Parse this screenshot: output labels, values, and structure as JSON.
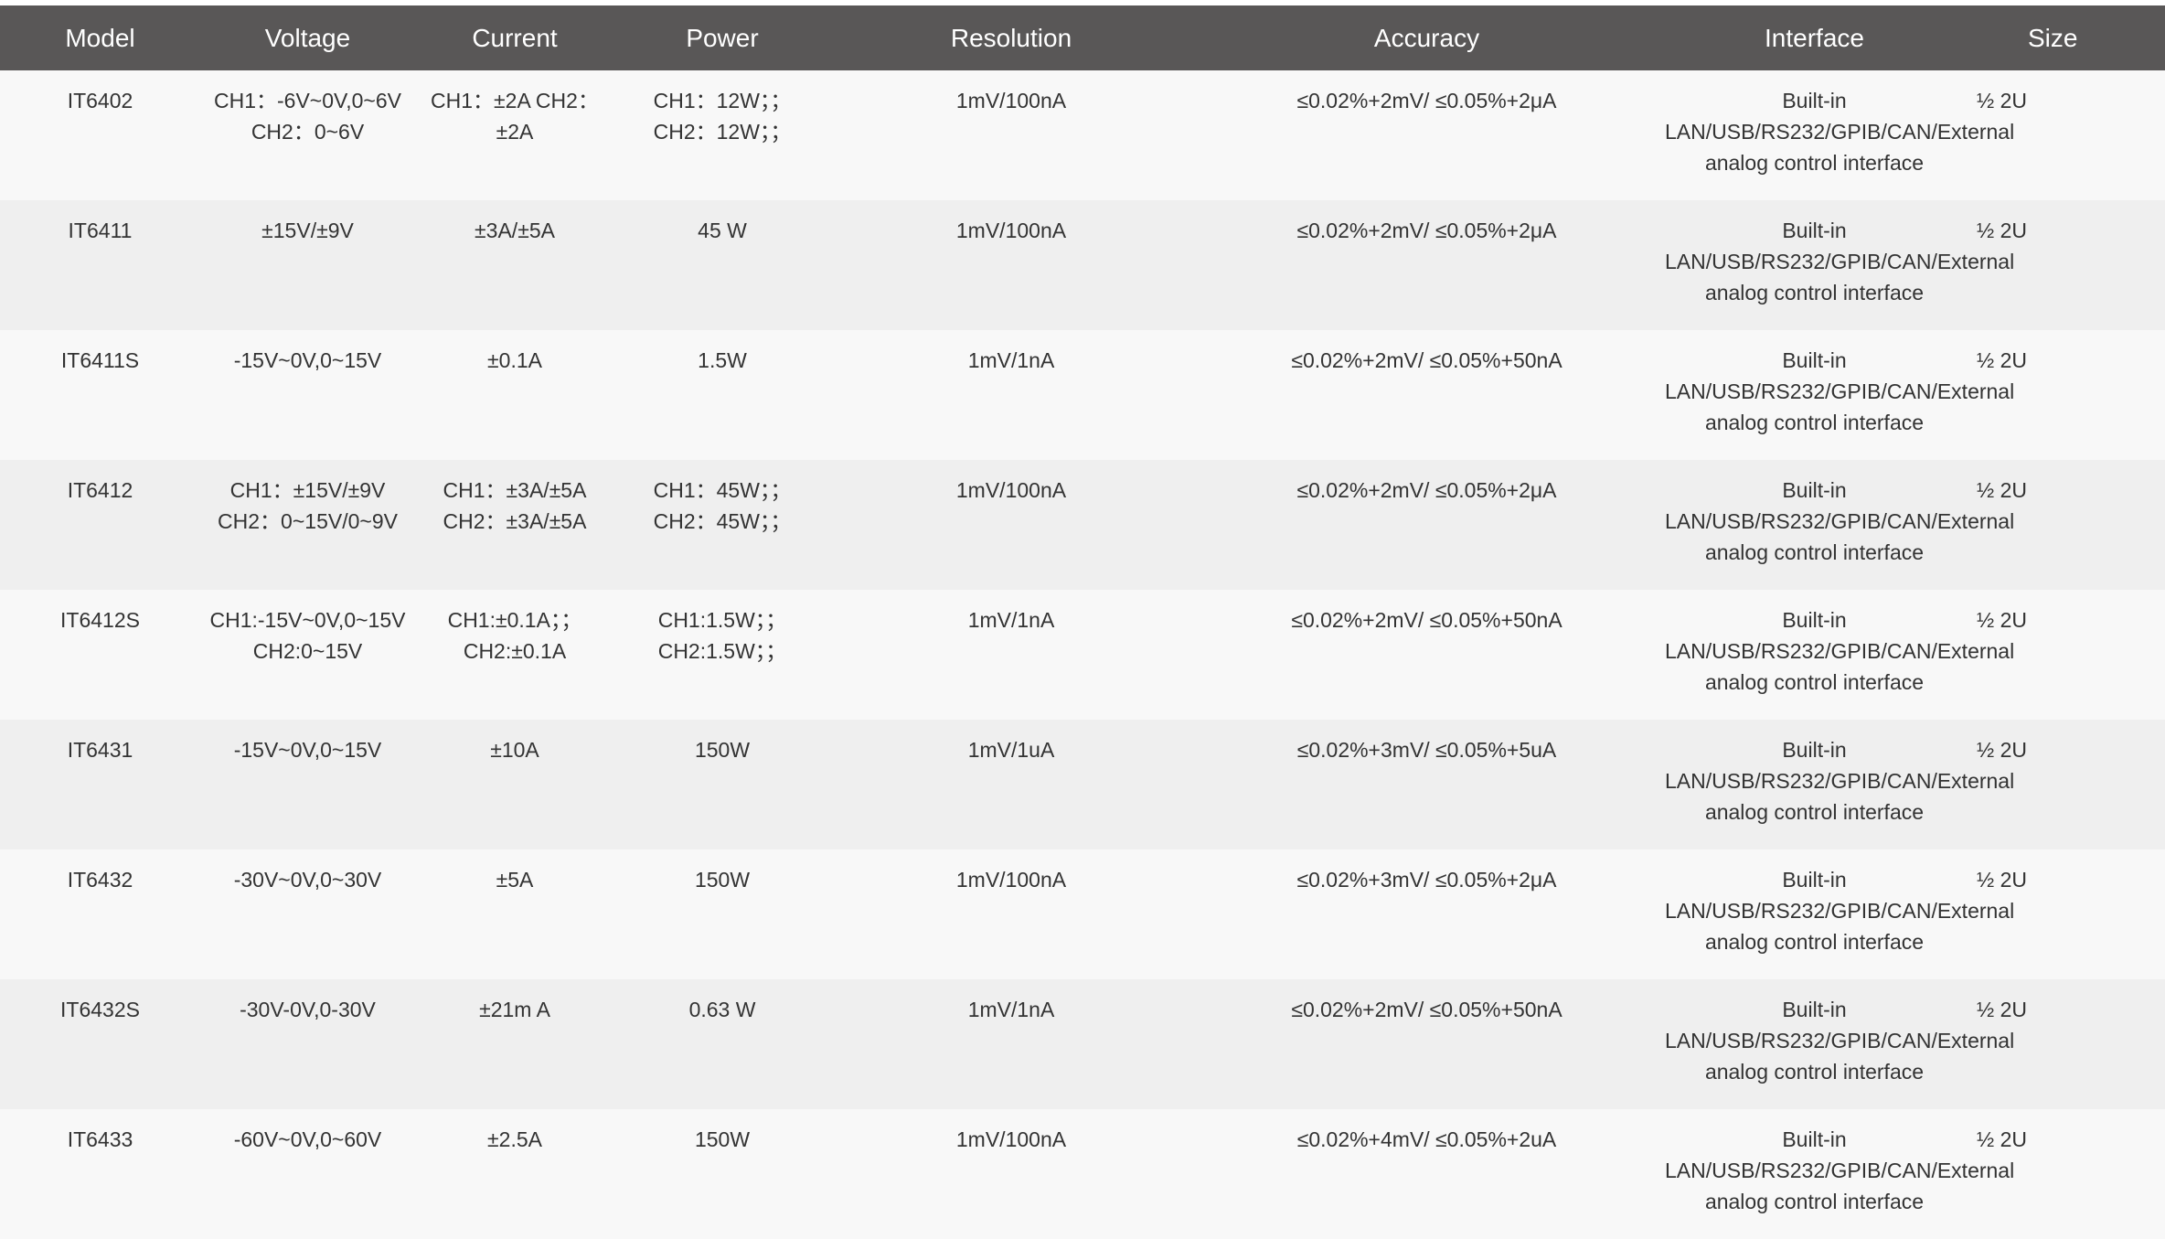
{
  "table": {
    "headers": [
      "Model",
      "Voltage",
      "Current",
      "Power",
      "Resolution",
      "Accuracy",
      "Interface",
      "Size"
    ],
    "rows": [
      {
        "model": "IT6402",
        "voltage": [
          "CH1：-6V~0V,0~6V",
          "CH2：0~6V"
        ],
        "current": [
          "CH1：±2A CH2：",
          "±2A"
        ],
        "power": [
          "CH1：12W；；",
          "CH2：12W；；"
        ],
        "resolution": "1mV/100nA",
        "accuracy": "≤0.02%+2mV/ ≤0.05%+2μA",
        "interface": [
          "Built-in",
          "LAN/USB/RS232/GPIB/CAN/External",
          "analog control interface"
        ],
        "size": "½ 2U"
      },
      {
        "model": "IT6411",
        "voltage": [
          "±15V/±9V"
        ],
        "current": [
          "±3A/±5A"
        ],
        "power": [
          "45 W"
        ],
        "resolution": "1mV/100nA",
        "accuracy": "≤0.02%+2mV/ ≤0.05%+2μA",
        "interface": [
          "Built-in",
          "LAN/USB/RS232/GPIB/CAN/External",
          "analog control interface"
        ],
        "size": "½ 2U"
      },
      {
        "model": "IT6411S",
        "voltage": [
          "-15V~0V,0~15V"
        ],
        "current": [
          "±0.1A"
        ],
        "power": [
          "1.5W"
        ],
        "resolution": "1mV/1nA",
        "accuracy": "≤0.02%+2mV/ ≤0.05%+50nA",
        "interface": [
          "Built-in",
          "LAN/USB/RS232/GPIB/CAN/External",
          "analog control interface"
        ],
        "size": "½ 2U"
      },
      {
        "model": "IT6412",
        "voltage": [
          "CH1：±15V/±9V",
          "CH2：0~15V/0~9V"
        ],
        "current": [
          "CH1：±3A/±5A",
          "CH2：±3A/±5A"
        ],
        "power": [
          "CH1：45W；；",
          "CH2：45W；；"
        ],
        "resolution": "1mV/100nA",
        "accuracy": "≤0.02%+2mV/ ≤0.05%+2μA",
        "interface": [
          "Built-in",
          "LAN/USB/RS232/GPIB/CAN/External",
          "analog control interface"
        ],
        "size": "½ 2U"
      },
      {
        "model": "IT6412S",
        "voltage": [
          "CH1:-15V~0V,0~15V",
          "CH2:0~15V"
        ],
        "current": [
          "CH1:±0.1A；；",
          "CH2:±0.1A"
        ],
        "power": [
          "CH1:1.5W；；",
          "CH2:1.5W；；"
        ],
        "resolution": "1mV/1nA",
        "accuracy": "≤0.02%+2mV/ ≤0.05%+50nA",
        "interface": [
          "Built-in",
          "LAN/USB/RS232/GPIB/CAN/External",
          "analog control interface"
        ],
        "size": "½ 2U"
      },
      {
        "model": "IT6431",
        "voltage": [
          "-15V~0V,0~15V"
        ],
        "current": [
          "±10A"
        ],
        "power": [
          "150W"
        ],
        "resolution": "1mV/1uA",
        "accuracy": "≤0.02%+3mV/ ≤0.05%+5uA",
        "interface": [
          "Built-in",
          "LAN/USB/RS232/GPIB/CAN/External",
          "analog control interface"
        ],
        "size": "½ 2U"
      },
      {
        "model": "IT6432",
        "voltage": [
          "-30V~0V,0~30V"
        ],
        "current": [
          "±5A"
        ],
        "power": [
          "150W"
        ],
        "resolution": "1mV/100nA",
        "accuracy": "≤0.02%+3mV/ ≤0.05%+2μA",
        "interface": [
          "Built-in",
          "LAN/USB/RS232/GPIB/CAN/External",
          "analog control interface"
        ],
        "size": "½ 2U"
      },
      {
        "model": "IT6432S",
        "voltage": [
          "-30V-0V,0-30V"
        ],
        "current": [
          "±21m A"
        ],
        "power": [
          "0.63 W"
        ],
        "resolution": "1mV/1nA",
        "accuracy": "≤0.02%+2mV/ ≤0.05%+50nA",
        "interface": [
          "Built-in",
          "LAN/USB/RS232/GPIB/CAN/External",
          "analog control interface"
        ],
        "size": "½ 2U"
      },
      {
        "model": "IT6433",
        "voltage": [
          "-60V~0V,0~60V"
        ],
        "current": [
          "±2.5A"
        ],
        "power": [
          "150W"
        ],
        "resolution": "1mV/100nA",
        "accuracy": "≤0.02%+4mV/ ≤0.05%+2uA",
        "interface": [
          "Built-in",
          "LAN/USB/RS232/GPIB/CAN/External",
          "analog control interface"
        ],
        "size": "½ 2U"
      }
    ]
  }
}
